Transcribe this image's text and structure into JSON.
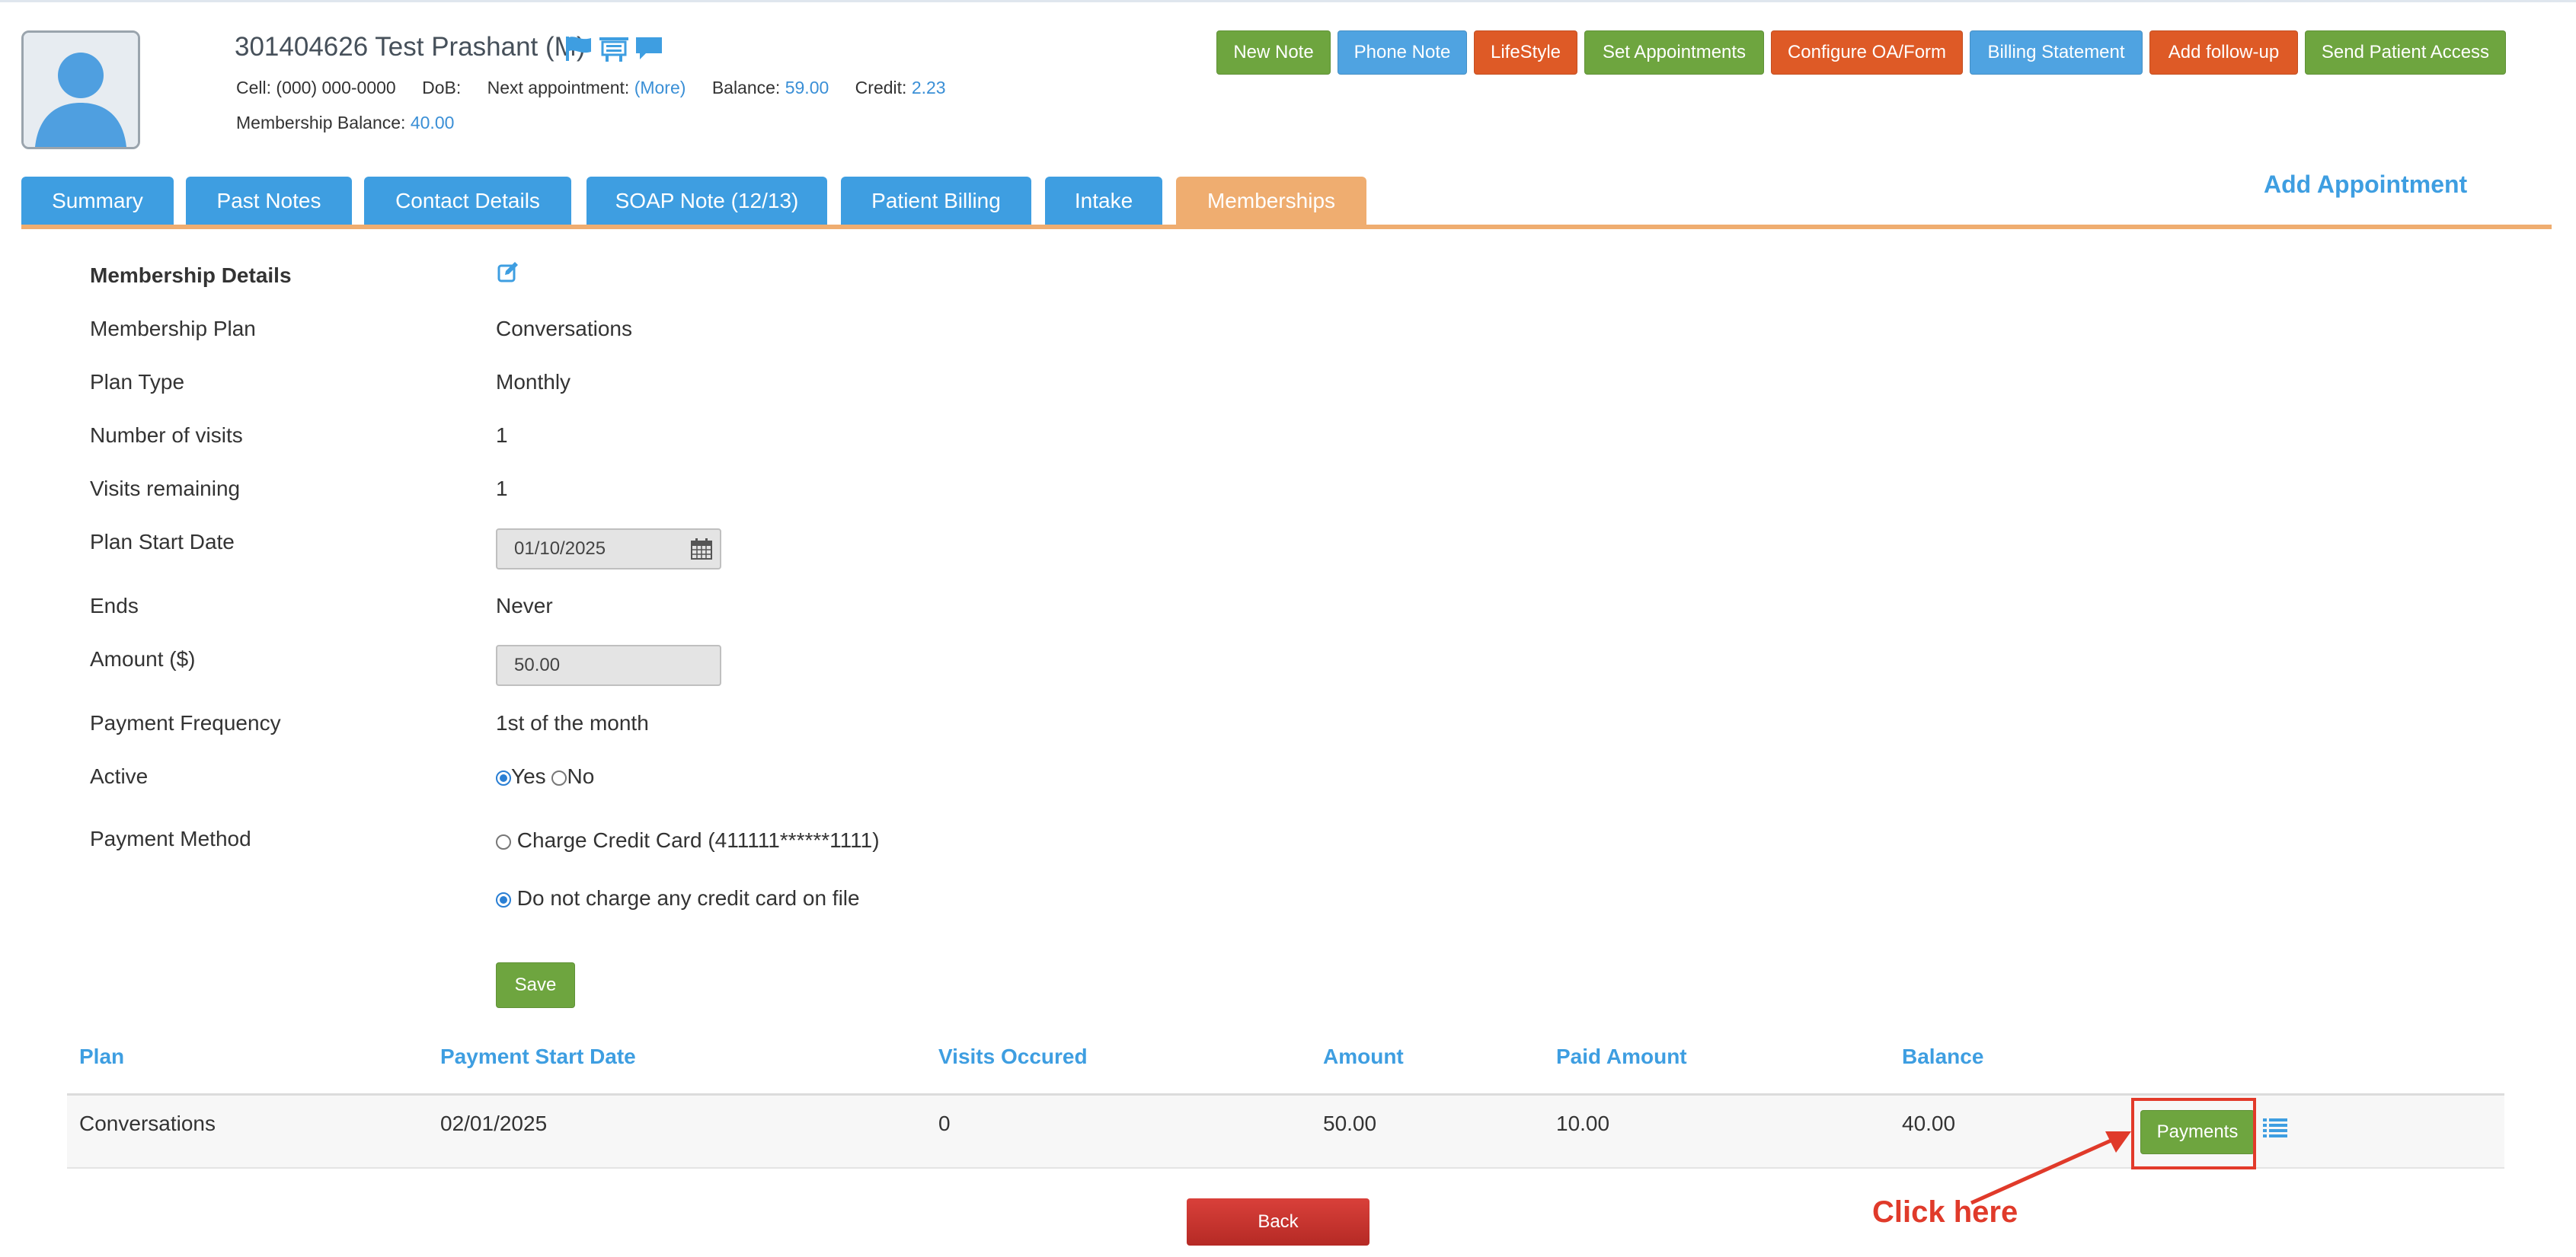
{
  "patient": {
    "title": "301404626 Test Prashant (M)",
    "cell_label": "Cell:",
    "cell_value": "(000) 000-0000",
    "dob_label": "DoB:",
    "next_appt_label": "Next appointment:",
    "next_appt_link": "(More)",
    "balance_label": "Balance:",
    "balance_value": "59.00",
    "credit_label": "Credit:",
    "credit_value": "2.23",
    "membership_balance_label": "Membership Balance:",
    "membership_balance_value": "40.00"
  },
  "header_buttons": [
    "New Note",
    "Phone Note",
    "LifeStyle",
    "Set Appointments",
    "Configure OA/Form",
    "Billing Statement",
    "Add follow-up",
    "Send Patient Access"
  ],
  "tabs": [
    "Summary",
    "Past Notes",
    "Contact Details",
    "SOAP Note (12/13)",
    "Patient Billing",
    "Intake",
    "Memberships"
  ],
  "active_tab": "Memberships",
  "add_appointment": "Add Appointment",
  "membership": {
    "heading": "Membership Details",
    "plan_label": "Membership Plan",
    "plan_value": "Conversations",
    "type_label": "Plan Type",
    "type_value": "Monthly",
    "visits_label": "Number of visits",
    "visits_value": "1",
    "remaining_label": "Visits remaining",
    "remaining_value": "1",
    "start_label": "Plan Start Date",
    "start_value": "01/10/2025",
    "ends_label": "Ends",
    "ends_value": "Never",
    "amount_label": "Amount ($)",
    "amount_value": "50.00",
    "frequency_label": "Payment Frequency",
    "frequency_value": "1st of the month",
    "active_label": "Active",
    "active_yes": "Yes",
    "active_no": "No",
    "method_label": "Payment Method",
    "method_option1": "Charge Credit Card (411111******1111)",
    "method_option2": "Do not charge any credit card on file",
    "save": "Save"
  },
  "table": {
    "headers": [
      "Plan",
      "Payment Start Date",
      "Visits Occured",
      "Amount",
      "Paid Amount",
      "Balance"
    ],
    "rows": [
      [
        "Conversations",
        "02/01/2025",
        "0",
        "50.00",
        "10.00",
        "40.00"
      ]
    ],
    "payments_button": "Payments"
  },
  "back": "Back",
  "annotation": "Click here",
  "colors": {
    "accent_blue": "#3e9ee1",
    "active_tab": "#efad70",
    "green": "#6ea53f",
    "orange": "#de5a26",
    "annotation_red": "#e03a2a"
  }
}
